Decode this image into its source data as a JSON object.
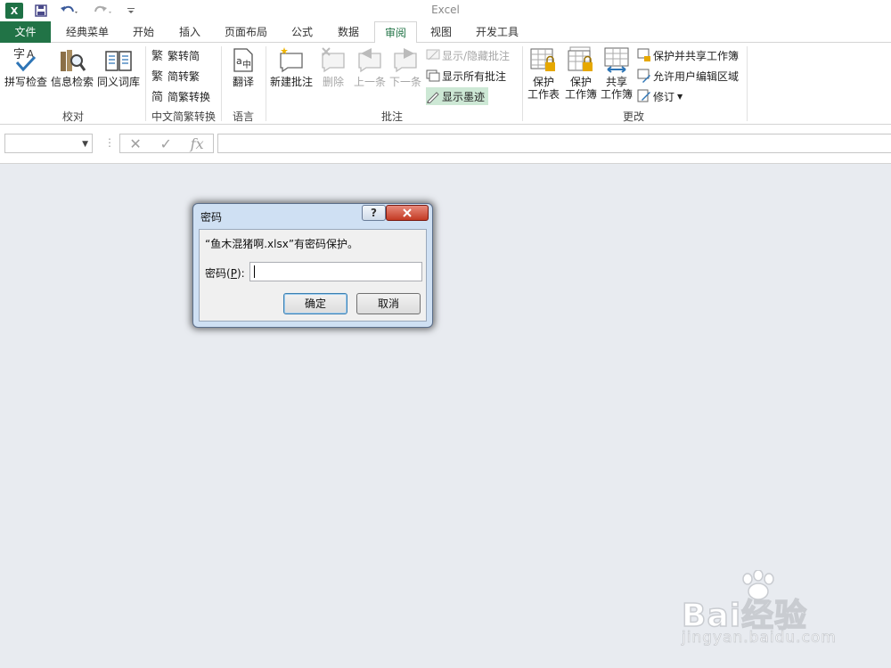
{
  "app": {
    "title": "Excel"
  },
  "quick_access": {
    "logo_letter": "X",
    "save_icon": "save-icon",
    "undo_icon": "undo-icon",
    "redo_icon": "redo-icon",
    "customize_icon": "customize-icon"
  },
  "tabs": [
    {
      "label": "文件"
    },
    {
      "label": "经典菜单"
    },
    {
      "label": "开始"
    },
    {
      "label": "插入"
    },
    {
      "label": "页面布局"
    },
    {
      "label": "公式"
    },
    {
      "label": "数据"
    },
    {
      "label": "审阅"
    },
    {
      "label": "视图"
    },
    {
      "label": "开发工具"
    }
  ],
  "active_tab": "审阅",
  "ribbon": {
    "proofing": {
      "label": "校对",
      "spell": "拼写检查",
      "research": "信息检索",
      "thesaurus": "同义词库"
    },
    "chinese": {
      "label": "中文简繁转换",
      "t2s": "繁转简",
      "s2t": "简转繁",
      "convert": "简繁转换"
    },
    "language": {
      "label": "语言",
      "translate": "翻译"
    },
    "comments": {
      "label": "批注",
      "new": "新建批注",
      "delete": "删除",
      "prev": "上一条",
      "next": "下一条",
      "show_hide": "显示/隐藏批注",
      "show_all": "显示所有批注",
      "show_ink": "显示墨迹"
    },
    "changes": {
      "label": "更改",
      "protect_sheet_1": "保护",
      "protect_sheet_2": "工作表",
      "protect_wb_1": "保护",
      "protect_wb_2": "工作簿",
      "share_wb_1": "共享",
      "share_wb_2": "工作簿",
      "protect_share": "保护并共享工作簿",
      "allow_edit": "允许用户编辑区域",
      "track": "修订"
    }
  },
  "formula_bar": {
    "name_box": "",
    "fx": "fx",
    "formula": ""
  },
  "dialog": {
    "title": "密码",
    "help": "?",
    "close": "x",
    "message": "“鱼木混猪啊.xlsx”有密码保护。",
    "label_pre": "密码(",
    "label_key": "P",
    "label_post": "):",
    "value": "",
    "ok": "确定",
    "cancel": "取消"
  },
  "watermark": {
    "brand": "Bai经验",
    "url": "jingyan.baidu.com"
  },
  "colors": {
    "excel_green": "#217346",
    "background": "#e8ebf0",
    "dialog_frame": "#cfe0f3",
    "close_red": "#c33b24"
  }
}
